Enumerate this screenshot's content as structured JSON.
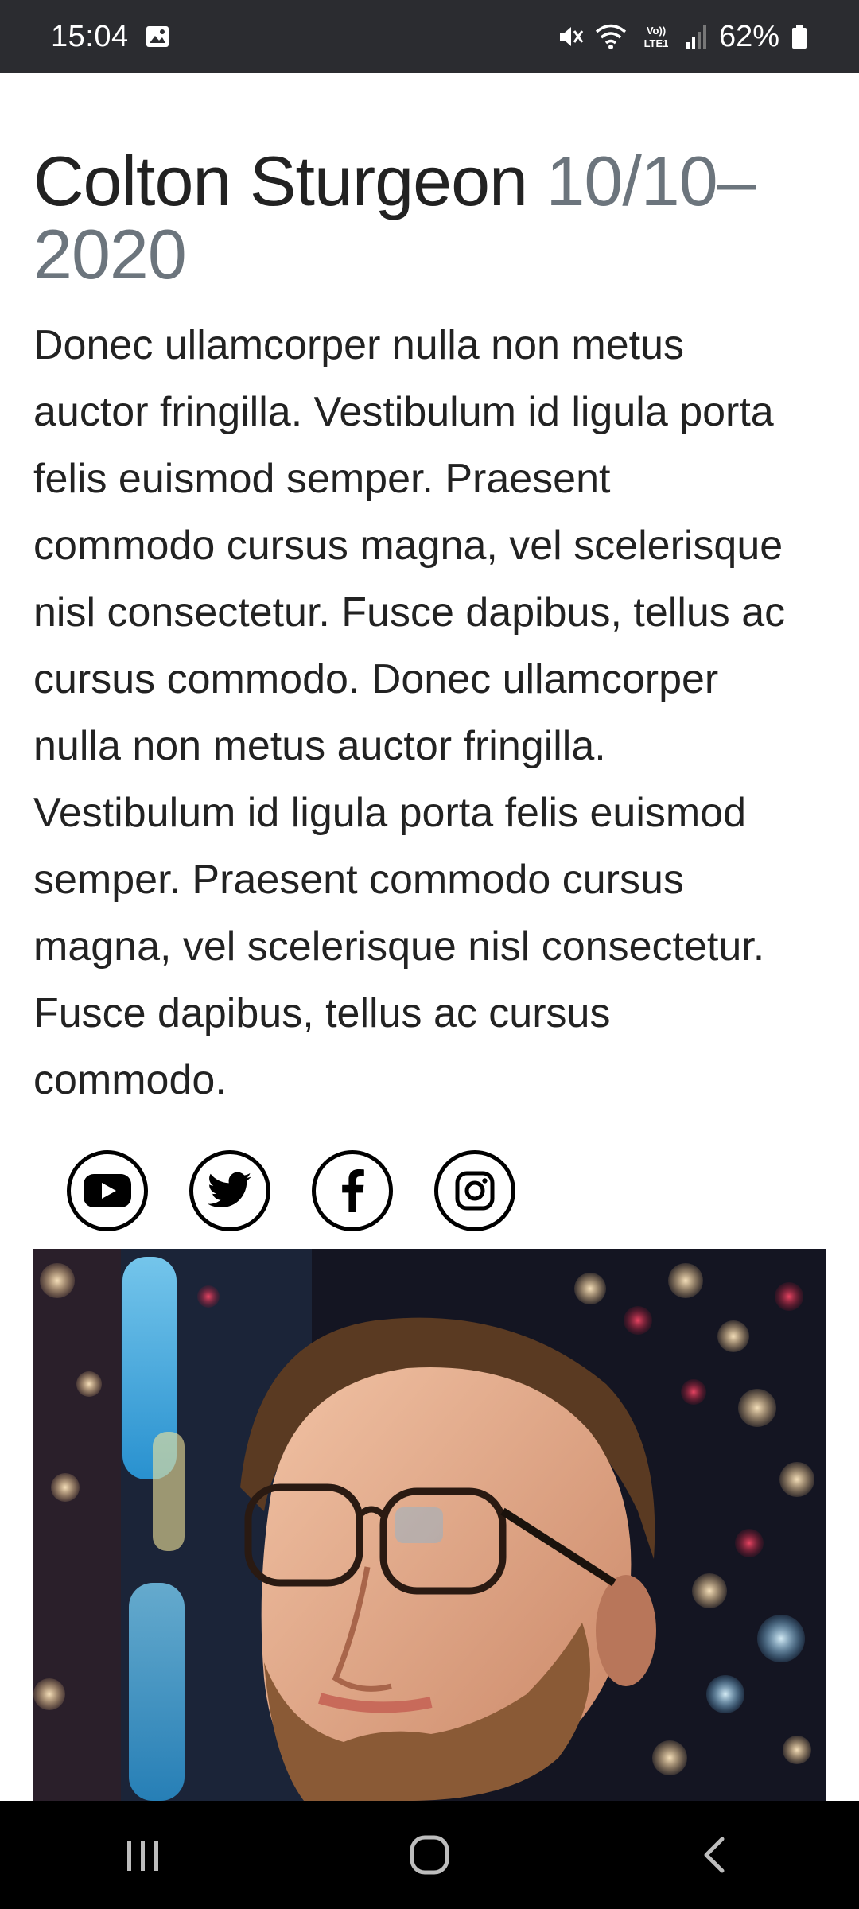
{
  "status_bar": {
    "time": "15:04",
    "battery_percent": "62%",
    "network_label": "VoLTE1",
    "icons": [
      "gallery-icon",
      "mute-icon",
      "wifi-icon",
      "volte-icon",
      "signal-icon",
      "battery-icon"
    ]
  },
  "profile": {
    "name": "Colton Sturgeon",
    "dates": "10/10–2020",
    "bio": "Donec ullamcorper nulla non metus auctor fringilla. Vestibulum id ligula porta felis euismod semper. Praesent commodo cursus magna, vel scelerisque nisl consectetur. Fusce dapibus, tellus ac cursus commodo. Donec ullamcorper nulla non metus auctor fringilla. Vestibulum id ligula porta felis euismod semper. Praesent commodo cursus magna, vel scelerisque nisl consectetur. Fusce dapibus, tellus ac cursus commodo."
  },
  "social": [
    {
      "name": "youtube",
      "icon": "youtube-icon"
    },
    {
      "name": "twitter",
      "icon": "twitter-icon"
    },
    {
      "name": "facebook",
      "icon": "facebook-icon"
    },
    {
      "name": "instagram",
      "icon": "instagram-icon"
    }
  ],
  "nav_bar": {
    "buttons": [
      "recent-apps-icon",
      "home-icon",
      "back-icon"
    ]
  },
  "colors": {
    "status_bar_bg": "#2b2c30",
    "text": "#222222",
    "muted_dates": "#6c757d",
    "nav_bar_bg": "#000000"
  }
}
